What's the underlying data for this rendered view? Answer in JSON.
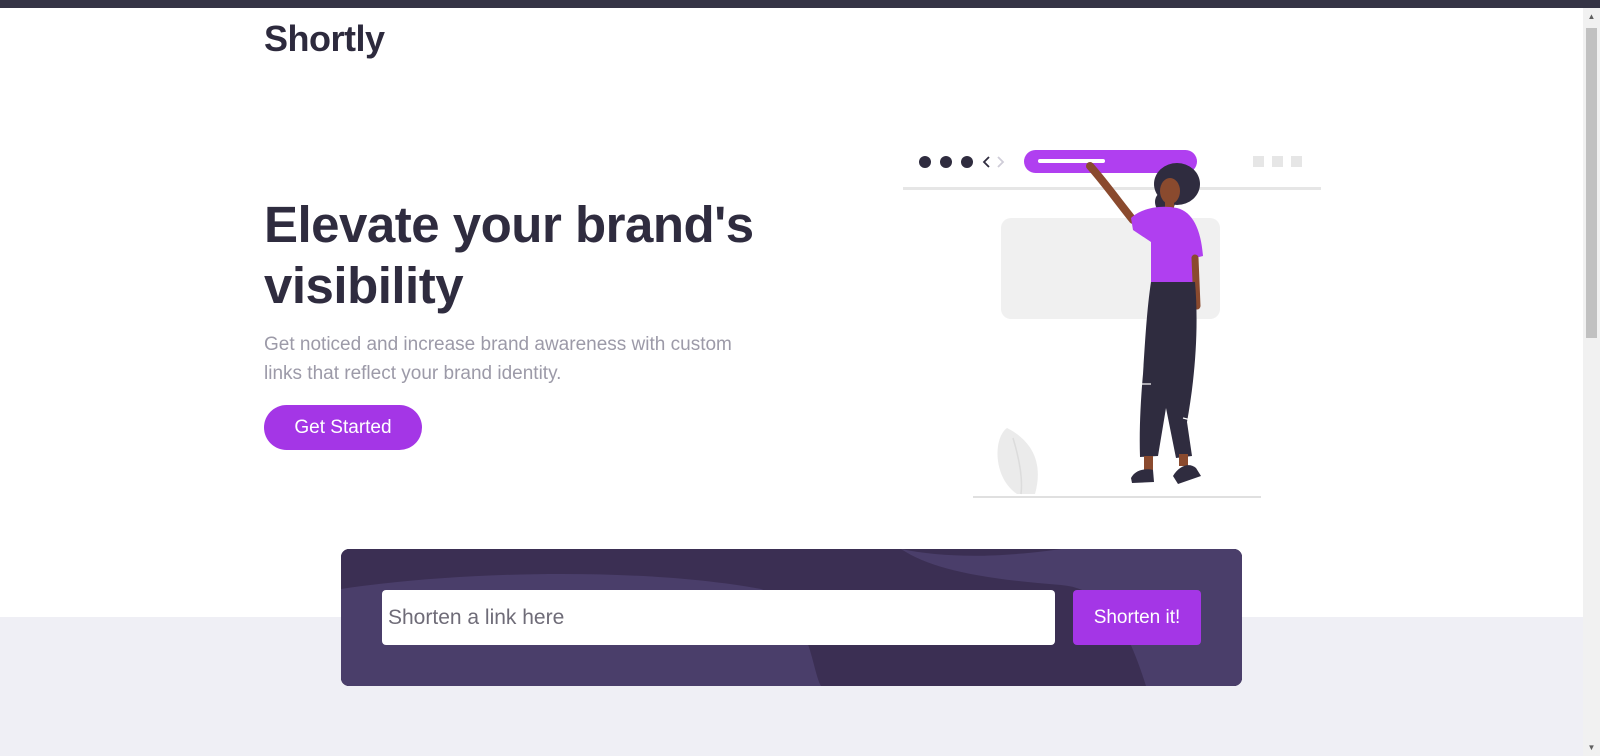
{
  "brand": {
    "logo_text": "Shortly"
  },
  "hero": {
    "headline": "Elevate your brand's visibility",
    "subtext": "Get noticed and increase brand awareness with custom links that reflect your brand identity.",
    "cta_label": "Get Started"
  },
  "shortener": {
    "placeholder": "Shorten a link here",
    "button_label": "Shorten it!"
  },
  "colors": {
    "accent": "#a436e6",
    "dark": "#2f2c3f",
    "panel": "#3b2f53",
    "muted_text": "#9c9aa8",
    "band": "#efeff5"
  },
  "icons": {
    "illustration": "woman-browser-illustration",
    "scroll_up": "scroll-up-arrow-icon",
    "scroll_down": "scroll-down-arrow-icon"
  }
}
